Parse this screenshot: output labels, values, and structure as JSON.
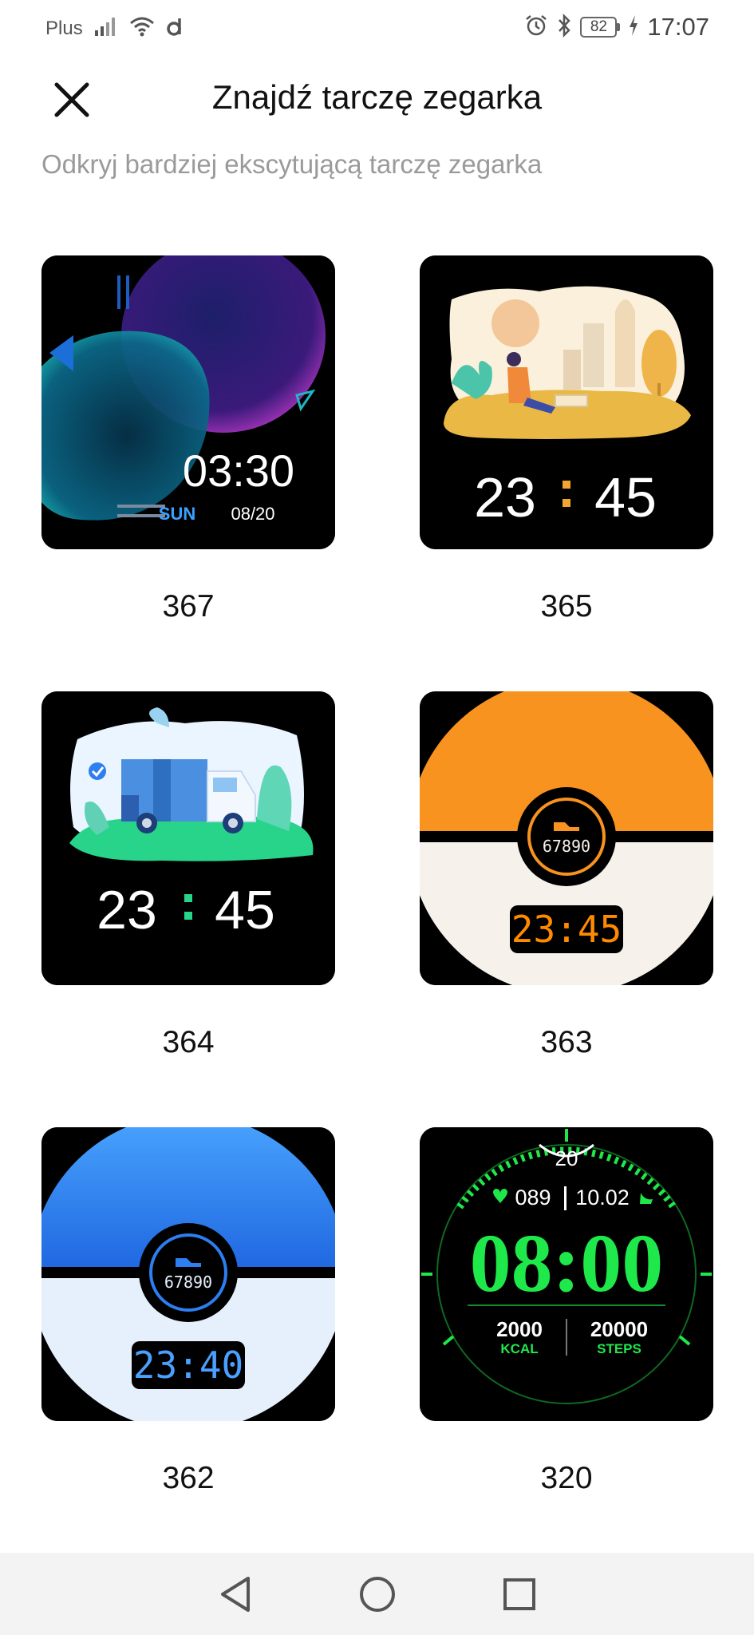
{
  "status_bar": {
    "carrier": "Plus",
    "battery_level": "82",
    "time": "17:07"
  },
  "header": {
    "title": "Znajdź tarczę zegarka",
    "subtitle": "Odkryj bardziej ekscytującą tarczę zegarka"
  },
  "faces": [
    {
      "label": "367",
      "time": "03:30",
      "day": "SUN",
      "date": "08/20"
    },
    {
      "label": "365",
      "hours": "23",
      "minutes": "45"
    },
    {
      "label": "364",
      "hours": "23",
      "minutes": "45"
    },
    {
      "label": "363",
      "steps": "67890",
      "time": "23:45"
    },
    {
      "label": "362",
      "steps": "67890",
      "time": "23:40"
    },
    {
      "label": "320",
      "top_value": "20",
      "heart_rate": "089",
      "date": "10.02",
      "time": "08:00",
      "kcal_value": "2000",
      "kcal_label": "KCAL",
      "steps_value": "20000",
      "steps_label": "STEPS"
    }
  ],
  "colors": {
    "orange": "#f7931e",
    "cream": "#f6f1ea",
    "blue": "#2d7ef0",
    "green": "#1ee84a",
    "cyan_time": "#4aa0ff",
    "orange_time": "#ff8a00"
  },
  "icons": {
    "close": "close-icon",
    "back": "back-triangle-icon",
    "home": "home-circle-icon",
    "recents": "recents-square-icon"
  }
}
